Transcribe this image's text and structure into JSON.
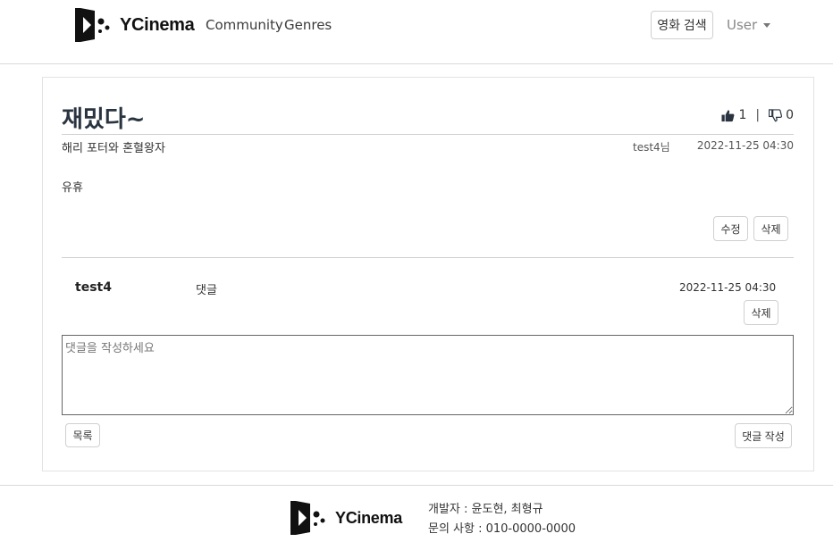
{
  "nav": {
    "brand": "YCinema",
    "links": [
      "Community",
      "Genres"
    ],
    "search_button": "영화 검색",
    "user_menu": "User"
  },
  "post": {
    "title": "재밌다~",
    "likes": "1",
    "dislikes": "0",
    "movie": "해리 포터와 혼혈왕자",
    "author": "test4님",
    "date": "2022-11-25 04:30",
    "content": "유휴",
    "edit_button": "수정",
    "delete_button": "삭제"
  },
  "comments": [
    {
      "author": "test4",
      "text": "댓글",
      "date": "2022-11-25 04:30",
      "delete_button": "삭제"
    }
  ],
  "comment_form": {
    "placeholder": "댓글을 작성하세요",
    "list_button": "목록",
    "submit_button": "댓글 작성"
  },
  "footer": {
    "brand": "YCinema",
    "developers": "개발자 : 윤도현, 최형규",
    "contact": "문의 사항 : 010-0000-0000"
  },
  "icons": {
    "logo": "play-dots-logo-icon",
    "like": "thumbs-up-icon",
    "dislike": "thumbs-down-icon",
    "dropdown": "caret-down-icon"
  }
}
